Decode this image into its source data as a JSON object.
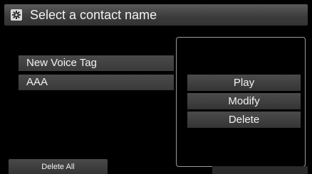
{
  "title_bar": {
    "title": "Select a contact name",
    "icon": "settings-gear-icon"
  },
  "contact_list": {
    "items": [
      {
        "label": "New Voice Tag"
      },
      {
        "label": "AAA"
      }
    ]
  },
  "popup_menu": {
    "items": [
      {
        "label": "Play"
      },
      {
        "label": "Modify"
      },
      {
        "label": "Delete"
      }
    ]
  },
  "footer": {
    "delete_all_label": "Delete All"
  },
  "colors": {
    "background": "#000000",
    "button": "#404040",
    "popup_border": "#9a9a9a",
    "text": "#f2f2f2"
  }
}
